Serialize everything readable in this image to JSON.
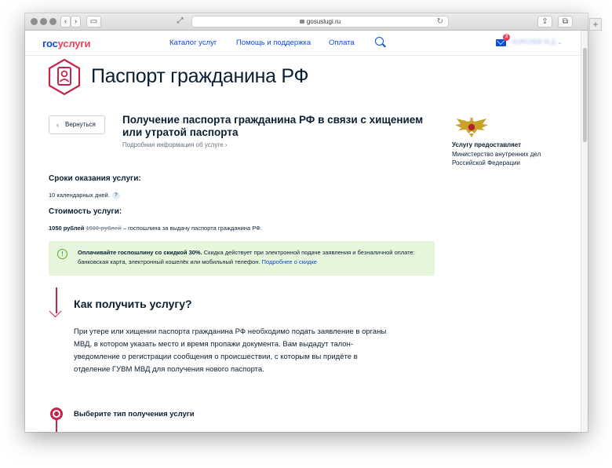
{
  "browser": {
    "url": "gosuslugi.ru",
    "back_glyph": "‹",
    "forward_glyph": "›",
    "sidebar_glyph": "▭",
    "reader_glyph": "⤢",
    "reload_glyph": "↻",
    "share_glyph": "⇪",
    "tabs_glyph": "⧉",
    "new_tab_glyph": "+"
  },
  "header": {
    "logo_part1": "гос",
    "logo_part2": "услуги",
    "nav": [
      "Каталог услуг",
      "Помощь и поддержка",
      "Оплата"
    ],
    "mail_count": "3",
    "user_name": "КОРОЛЕВ М.Д.",
    "user_chevron": "⌄"
  },
  "page": {
    "title": "Паспорт гражданина РФ",
    "back_label": "Вернуться",
    "back_chevron": "‹",
    "service_title": "Получение паспорта гражданина РФ в связи с хищением или утратой паспорта",
    "details_link": "Подробная информация об услуге",
    "details_chevron": "›"
  },
  "provider": {
    "label": "Услугу предоставляет",
    "name": "Министерство внутренних дел Российской Федерации"
  },
  "terms": {
    "title": "Сроки оказания услуги:",
    "value": "10 календарных дней.",
    "help": "?"
  },
  "cost": {
    "title": "Стоимость услуги:",
    "price": "1050 рублей",
    "old_price": "1500 рублей",
    "desc": "– госпошлина за выдачу паспорта гражданина РФ."
  },
  "notice": {
    "icon": "!",
    "bold": "Оплачивайте госпошлину со скидкой 30%.",
    "text": " Скидка действует при электронной подаче заявления и безналичной оплате: банковская карта, электронный кошелёк или мобильный телефон. ",
    "link": "Подробнее о скидке"
  },
  "how": {
    "title": "Как получить услугу?",
    "text": "При утере или хищении паспорта гражданина РФ необходимо подать заявление в органы МВД, в котором указать место и время пропажи документа. Вам выдадут талон-уведомление о регистрации сообщения о происшествии, с которым вы придёте в отделение ГУВМ МВД для получения нового паспорта."
  },
  "step": {
    "title": "Выберите тип получения услуги"
  },
  "colors": {
    "brand_blue": "#0d4cd3",
    "brand_red": "#ee3f58",
    "accent": "#c4264a",
    "notice_bg": "#e5f6dd"
  }
}
